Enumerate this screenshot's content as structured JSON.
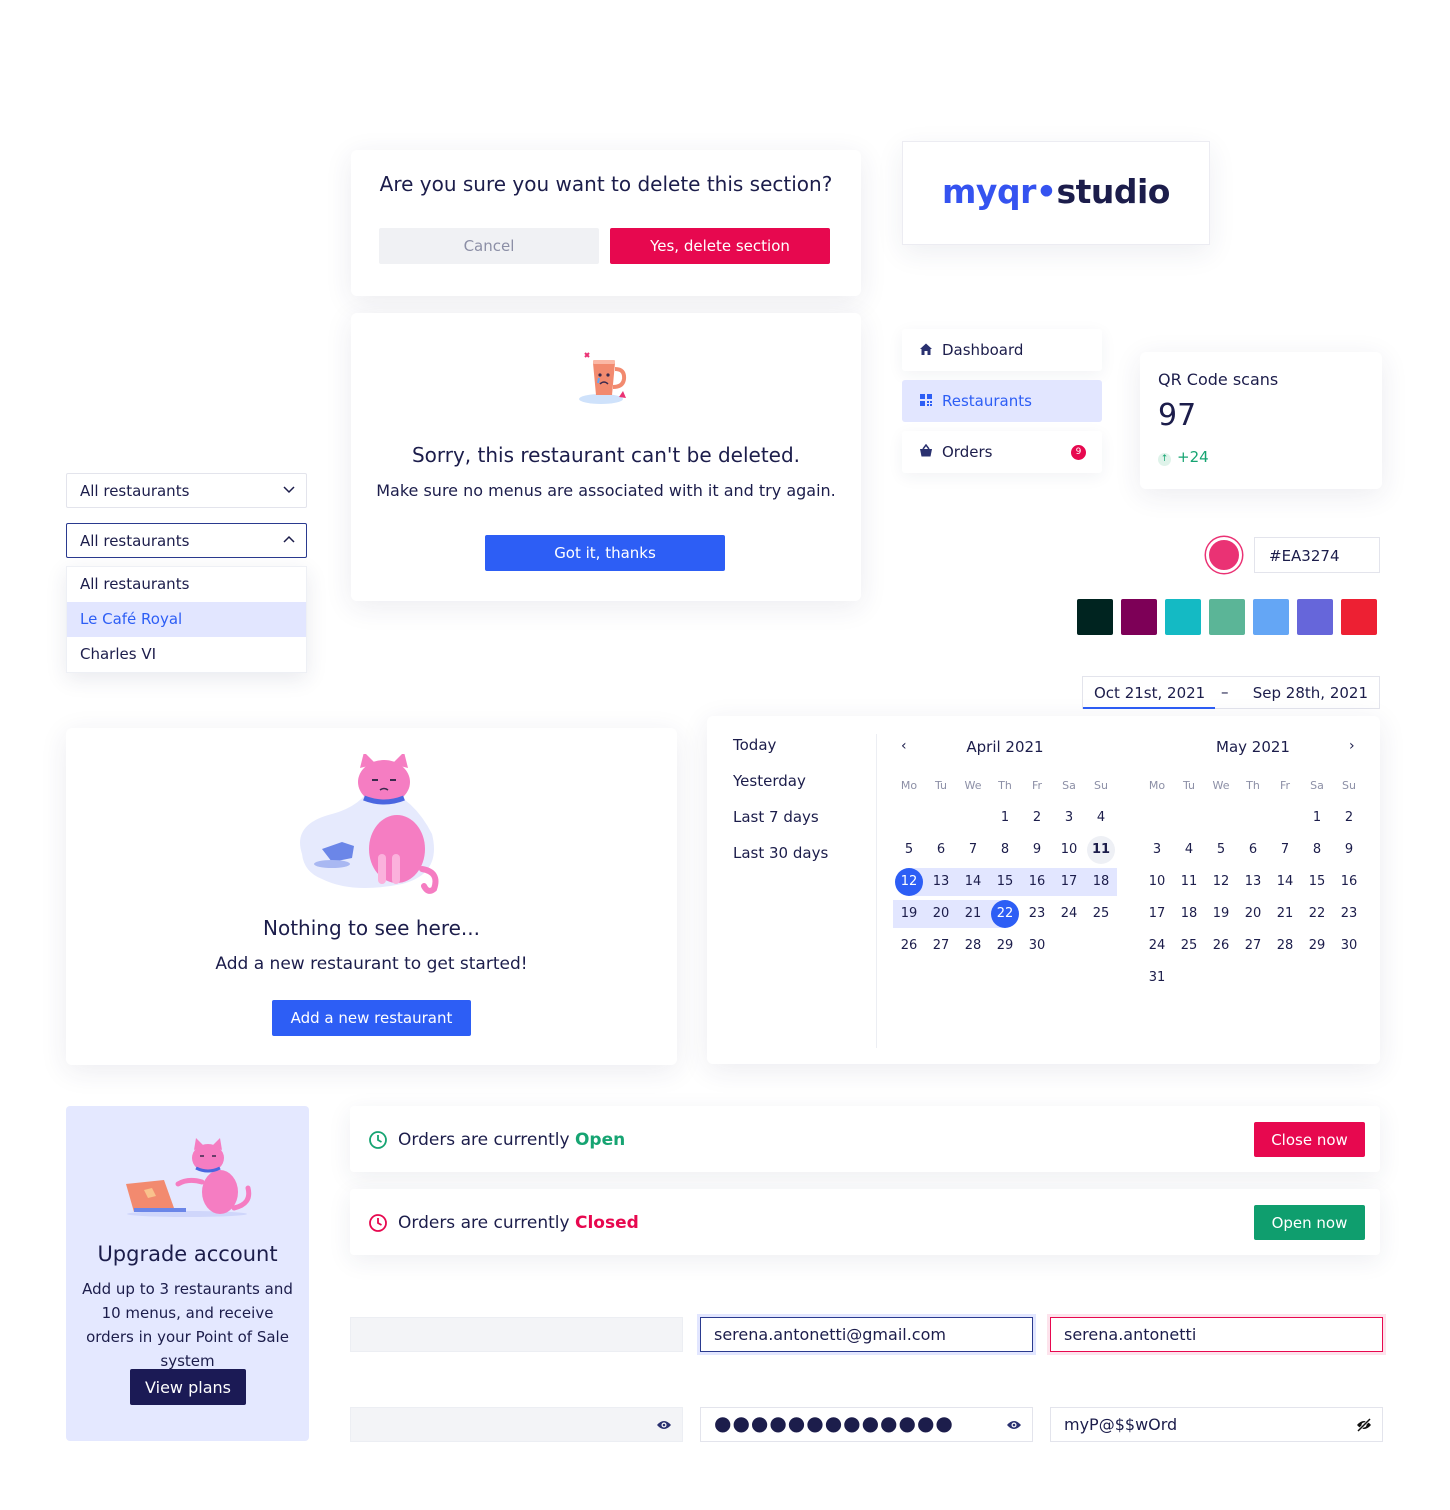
{
  "delete_dialog": {
    "title": "Are you sure you want to delete this section?",
    "cancel_label": "Cancel",
    "confirm_label": "Yes, delete section"
  },
  "logo": {
    "part1": "myqr",
    "dot": "•",
    "part2": "studio"
  },
  "sorry_dialog": {
    "title": "Sorry, this restaurant can't be deleted.",
    "message": "Make sure no menus are associated with it and try again.",
    "button_label": "Got it, thanks"
  },
  "nav": {
    "items": [
      {
        "label": "Dashboard",
        "icon": "home-icon"
      },
      {
        "label": "Restaurants",
        "icon": "qr-icon",
        "active": true
      },
      {
        "label": "Orders",
        "icon": "basket-icon",
        "badge": "9"
      }
    ]
  },
  "stats": {
    "title": "QR Code scans",
    "value": "97",
    "delta": "+24"
  },
  "select": {
    "closed_value": "All restaurants",
    "open_value": "All restaurants",
    "options": [
      "All restaurants",
      "Le Café Royal",
      "Charles VI"
    ],
    "selected_option": "Le Café Royal"
  },
  "color_picker": {
    "hex": "#EA3274",
    "current": "#EA3274",
    "swatches": [
      "#002420",
      "#7d0057",
      "#14bac4",
      "#5bb597",
      "#64a6f5",
      "#6666da",
      "#ed2033"
    ]
  },
  "date_range": {
    "start": "Oct 21st, 2021",
    "separator": "–",
    "end": "Sep 28th, 2021"
  },
  "calendar": {
    "presets": [
      "Today",
      "Yesterday",
      "Last 7 days",
      "Last 30 days"
    ],
    "prev": "‹",
    "next": "›",
    "weekdays": [
      "Mo",
      "Tu",
      "We",
      "Th",
      "Fr",
      "Sa",
      "Su"
    ],
    "months": [
      {
        "name": "April 2021",
        "offset": 3,
        "days": 30,
        "today": 11,
        "range_start": 12,
        "range_end": 22
      },
      {
        "name": "May 2021",
        "offset": 5,
        "days": 31
      }
    ]
  },
  "empty_state": {
    "title": "Nothing to see here...",
    "message": "Add a new restaurant to get started!",
    "button_label": "Add a new restaurant"
  },
  "orders": {
    "open_text": "Orders are currently ",
    "open_status": "Open",
    "open_button": "Close now",
    "closed_text": "Orders are currently ",
    "closed_status": "Closed",
    "closed_button": "Open now"
  },
  "upgrade": {
    "title": "Upgrade account",
    "body": "Add up to 3 restaurants and 10 menus, and receive orders in your Point of Sale system",
    "button_label": "View plans"
  },
  "inputs": {
    "email_focus": "serena.antonetti@gmail.com",
    "email_error": "serena.antonetti",
    "password_masked": "●●●●●●●●●●●●●",
    "password_visible": "myP@$$wOrd"
  }
}
